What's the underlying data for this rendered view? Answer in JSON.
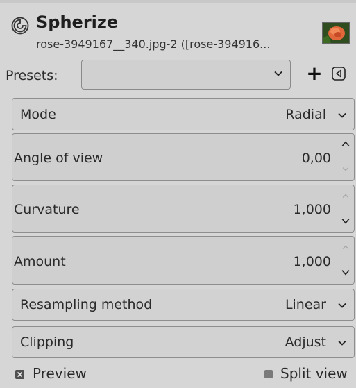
{
  "header": {
    "title": "Spherize",
    "subtitle": "rose-3949167__340.jpg-2 ([rose-394916..."
  },
  "presets": {
    "label": "Presets:",
    "value": "",
    "add_label": "+"
  },
  "mode": {
    "label": "Mode",
    "value": "Radial"
  },
  "angle_of_view": {
    "label": "Angle of view",
    "value": "0,00"
  },
  "curvature": {
    "label": "Curvature",
    "value": "1,000"
  },
  "amount": {
    "label": "Amount",
    "value": "1,000"
  },
  "resampling": {
    "label": "Resampling method",
    "value": "Linear"
  },
  "clipping": {
    "label": "Clipping",
    "value": "Adjust"
  },
  "footer": {
    "preview_label": "Preview",
    "preview_checked": true,
    "split_view_label": "Split view",
    "split_view_checked": false
  },
  "icons": {
    "header_icon": "gimp-spiral-icon",
    "menu_icon": "triangle-left-icon",
    "dropdown_icon": "chevron-down-icon"
  }
}
